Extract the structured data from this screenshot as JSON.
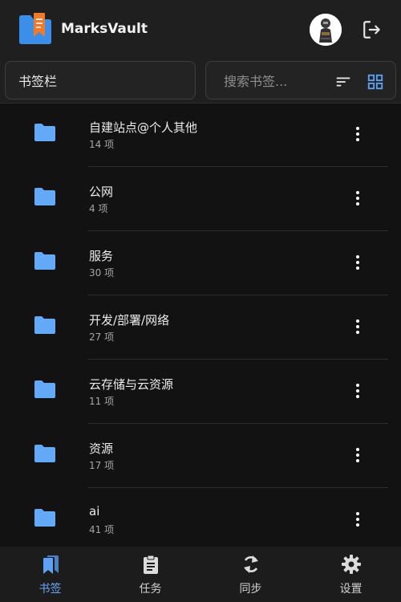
{
  "app": {
    "title": "MarksVault"
  },
  "toolbar": {
    "folder_label": "书签栏",
    "search_placeholder": "搜索书签..."
  },
  "folders": [
    {
      "name": "自建站点@个人其他",
      "count": "14 项"
    },
    {
      "name": "公网",
      "count": "4 项"
    },
    {
      "name": "服务",
      "count": "30 项"
    },
    {
      "name": "开发/部署/网络",
      "count": "27 项"
    },
    {
      "name": "云存储与云资源",
      "count": "11 项"
    },
    {
      "name": "资源",
      "count": "17 项"
    },
    {
      "name": "ai",
      "count": "41 项"
    }
  ],
  "nav": {
    "items": [
      {
        "label": "书签",
        "icon": "bookmark-icon",
        "active": true
      },
      {
        "label": "任务",
        "icon": "clipboard-icon",
        "active": false
      },
      {
        "label": "同步",
        "icon": "sync-icon",
        "active": false
      },
      {
        "label": "设置",
        "icon": "gear-icon",
        "active": false
      }
    ]
  },
  "colors": {
    "accent": "#5ea2f7",
    "folder": "#64a9f8",
    "background": "#121212",
    "header": "#1f1f1f"
  }
}
